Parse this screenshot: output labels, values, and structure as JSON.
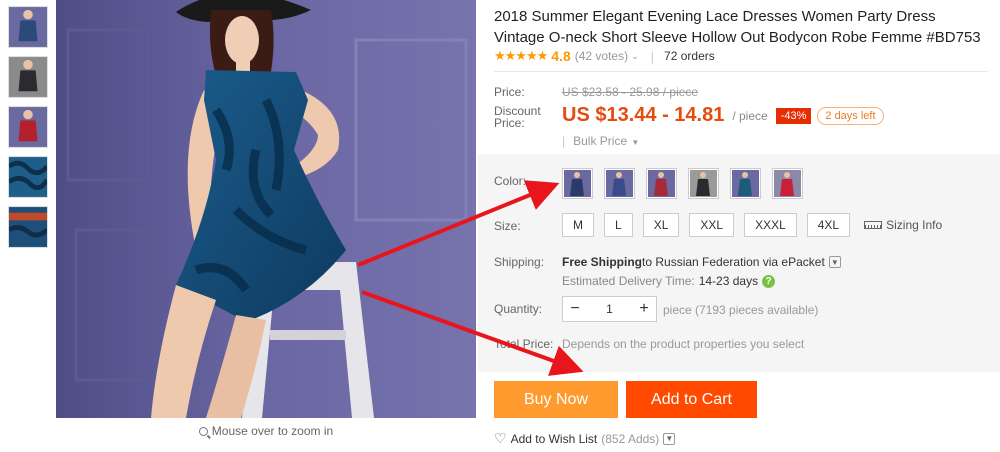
{
  "thumbnails": [
    {
      "color": "#2b4a7c"
    },
    {
      "color": "#2a2a30"
    },
    {
      "color": "#b41f2c"
    },
    {
      "color": "#1e5f8a"
    },
    {
      "color": "#c04a2a"
    }
  ],
  "zoom_hint": "Mouse over to zoom in",
  "product": {
    "title": "2018 Summer Elegant Evening Lace Dresses Women Party Dress Vintage O-neck Short Sleeve Hollow Out Bodycon Robe Femme #BD753",
    "stars": "★★★★★",
    "rating": "4.8",
    "votes": "(42 votes)",
    "orders": "72 orders"
  },
  "price": {
    "label": "Price:",
    "original": "US $23.58 - 25.98 / piece",
    "discount_label_1": "Discount",
    "discount_label_2": "Price:",
    "discount": "US $13.44 - 14.81",
    "per_piece": "/ piece",
    "percent_off": "-43%",
    "days_left": "2 days left",
    "bulk": "Bulk Price"
  },
  "options": {
    "color_label": "Color:",
    "swatches": [
      {
        "color": "#2c3a6a",
        "name": "navy"
      },
      {
        "color": "#3a4a8c",
        "name": "blue"
      },
      {
        "color": "#a82a3a",
        "name": "red"
      },
      {
        "color": "#2a2a30",
        "name": "black"
      },
      {
        "color": "#1e5a7a",
        "name": "teal"
      },
      {
        "color": "#c8203a",
        "name": "crimson"
      }
    ],
    "size_label": "Size:",
    "sizes": [
      "M",
      "L",
      "XL",
      "XXL",
      "XXXL",
      "4XL"
    ],
    "sizing_info": "Sizing Info",
    "shipping_label": "Shipping:",
    "shipping_strong": "Free Shipping",
    "shipping_rest": " to Russian Federation via ePacket",
    "delivery_label": "Estimated Delivery Time:",
    "delivery_days": "14-23 days",
    "quantity_label": "Quantity:",
    "quantity_value": "1",
    "quantity_info": "piece (7193 pieces available)",
    "total_label": "Total Price:",
    "total_text": "Depends on the product properties you select"
  },
  "actions": {
    "buy_now": "Buy Now",
    "add_to_cart": "Add to Cart",
    "wish": "Add to Wish List",
    "wish_count": "(852 Adds)"
  },
  "colors": {
    "accent": "#ff9900",
    "discount": "#e64b0f",
    "buy": "#ff9a2e",
    "cart": "#ff4a00",
    "annotation_arrow": "#e8161c"
  }
}
